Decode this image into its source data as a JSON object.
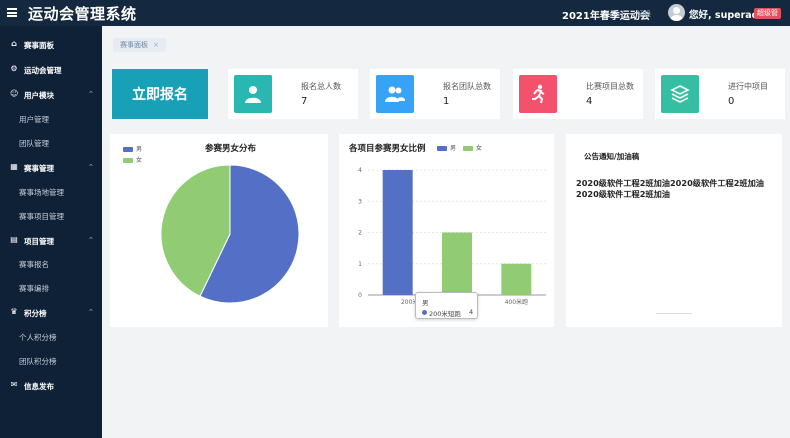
{
  "header": {
    "title": "运动会管理系统",
    "event_name": "2021年春季运动会",
    "event_caret": "切换",
    "greeting": "您好, superadmin",
    "role_badge": "超级管"
  },
  "sidebar": [
    {
      "kind": "active",
      "icon": "home-icon",
      "label": "赛事面板"
    },
    {
      "kind": "group",
      "icon": "gear-icon",
      "label": "运动会管理"
    },
    {
      "kind": "group",
      "icon": "user-icon",
      "label": "用户模块"
    },
    {
      "kind": "sub",
      "label": "用户管理"
    },
    {
      "kind": "sub",
      "label": "团队管理"
    },
    {
      "kind": "group",
      "icon": "grid-icon",
      "label": "赛事管理"
    },
    {
      "kind": "sub",
      "label": "赛事场地管理"
    },
    {
      "kind": "sub",
      "label": "赛事项目管理"
    },
    {
      "kind": "group",
      "icon": "file-icon",
      "label": "项目管理"
    },
    {
      "kind": "sub",
      "label": "赛事报名"
    },
    {
      "kind": "sub",
      "label": "赛事编排"
    },
    {
      "kind": "group",
      "icon": "trophy-icon",
      "label": "积分榜"
    },
    {
      "kind": "sub",
      "label": "个人积分榜"
    },
    {
      "kind": "sub",
      "label": "团队积分榜"
    },
    {
      "kind": "group",
      "icon": "mail-icon",
      "label": "信息发布"
    }
  ],
  "breadcrumb": {
    "label": "赛事面板",
    "close": "×"
  },
  "register_button": "立即报名",
  "stats": [
    {
      "label": "报名总人数",
      "value": "7",
      "color": "#28b7b1",
      "icon": "person-icon"
    },
    {
      "label": "报名团队总数",
      "value": "1",
      "color": "#36a3f7",
      "icon": "team-icon"
    },
    {
      "label": "比赛项目总数",
      "value": "4",
      "color": "#f4516c",
      "icon": "runner-icon"
    },
    {
      "label": "进行中项目",
      "value": "0",
      "color": "#34bfa3",
      "icon": "layers-icon"
    }
  ],
  "notice": {
    "title": "公告通知/加油稿",
    "text": "2020级软件工程2班加油2020级软件工程2班加油2020级软件工程2班加油"
  },
  "chart_data": [
    {
      "type": "pie",
      "title": "参赛男女分布",
      "legend": [
        "男",
        "女"
      ],
      "colors": [
        "#5470c6",
        "#91cc75"
      ],
      "values": [
        4,
        3
      ]
    },
    {
      "type": "bar",
      "title": "各项目参赛男女比例",
      "categories": [
        "200米短跑",
        "",
        "400米跑"
      ],
      "tick_labels": [
        "200米",
        "",
        "400米跑"
      ],
      "series": [
        {
          "name": "男",
          "values": [
            4,
            0,
            0
          ]
        },
        {
          "name": "女",
          "values": [
            0,
            2,
            1
          ]
        }
      ],
      "colors": [
        "#5470c6",
        "#91cc75"
      ],
      "ylim": [
        0,
        4
      ],
      "yticks": [
        0,
        1,
        2,
        3,
        4
      ],
      "tooltip": {
        "title": "男",
        "name": "200米短跑",
        "value": "4"
      }
    }
  ]
}
